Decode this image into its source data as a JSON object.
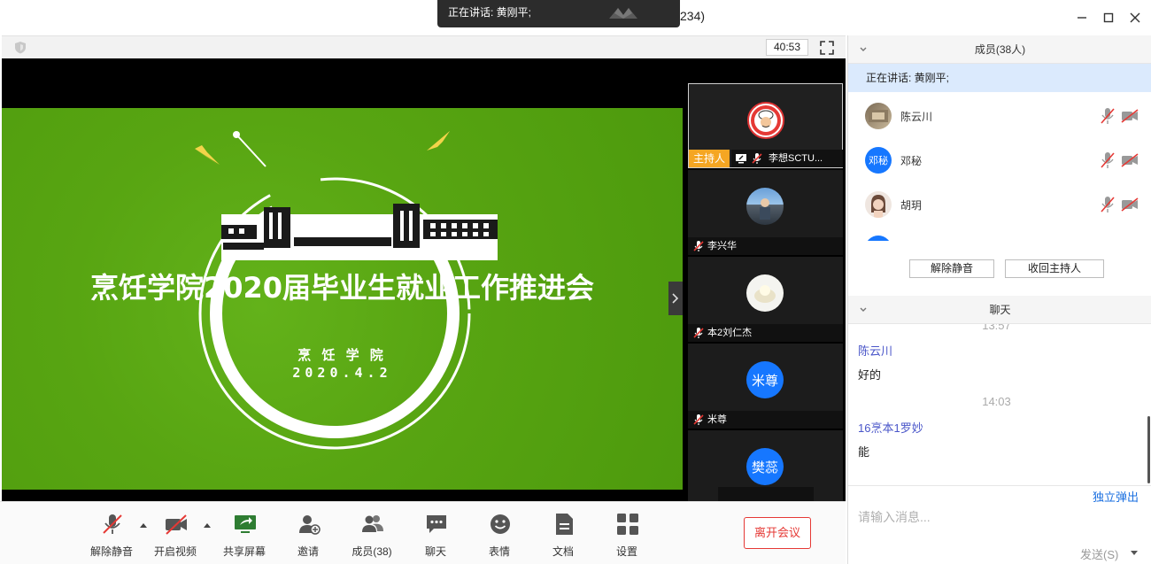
{
  "window": {
    "speaking_toast": "正在讲话: 黄刚平;",
    "title_suffix": "234)"
  },
  "video": {
    "timer": "40:53",
    "slide": {
      "title": "烹饪学院2020届毕业生就业工作推进会",
      "org": "烹 饪 学 院",
      "date": "2020.4.2"
    },
    "thumbnails": [
      {
        "name": "李想SCTU...",
        "host_tag": "主持人",
        "avatar_type": "logo"
      },
      {
        "name": "李兴华",
        "avatar_type": "photo"
      },
      {
        "name": "本2刘仁杰",
        "avatar_type": "photo-light"
      },
      {
        "name": "米尊",
        "avatar_text": "米尊",
        "avatar_color": "#1677ff"
      },
      {
        "name": "",
        "avatar_text": "樊蕊",
        "avatar_color": "#1677ff"
      }
    ]
  },
  "toolbar": {
    "unmute": "解除静音",
    "start_video": "开启视频",
    "share_screen": "共享屏幕",
    "invite": "邀请",
    "members": "成员(38)",
    "chat": "聊天",
    "reactions": "表情",
    "docs": "文档",
    "settings": "设置",
    "leave": "离开会议"
  },
  "panel": {
    "members_header": "成员(38人)",
    "speaking": "正在讲话: 黄刚平;",
    "members": [
      {
        "name": "陈云川",
        "avatar_type": "photo"
      },
      {
        "name": "邓秘",
        "avatar_text": "邓秘",
        "avatar_color": "#1677ff"
      },
      {
        "name": "胡玥",
        "avatar_type": "photo-face"
      },
      {
        "name": "",
        "avatar_text": "",
        "avatar_color": "#1677ff"
      }
    ],
    "unmute_all": "解除静音",
    "reclaim_host": "收回主持人",
    "chat_header": "聊天",
    "chat": [
      {
        "time": "13:57"
      },
      {
        "sender": "陈云川",
        "text": "好的"
      },
      {
        "time": "14:03"
      },
      {
        "sender": "16烹本1罗妙",
        "text": "能"
      }
    ],
    "popout": "独立弹出",
    "input_placeholder": "请输入消息...",
    "send": "发送(S)"
  },
  "colors": {
    "slide_green": "#58a512",
    "accent_blue": "#1677ff",
    "host_orange": "#f5a623",
    "leave_red": "#e53935",
    "speaking_bg": "#dbeafd"
  }
}
